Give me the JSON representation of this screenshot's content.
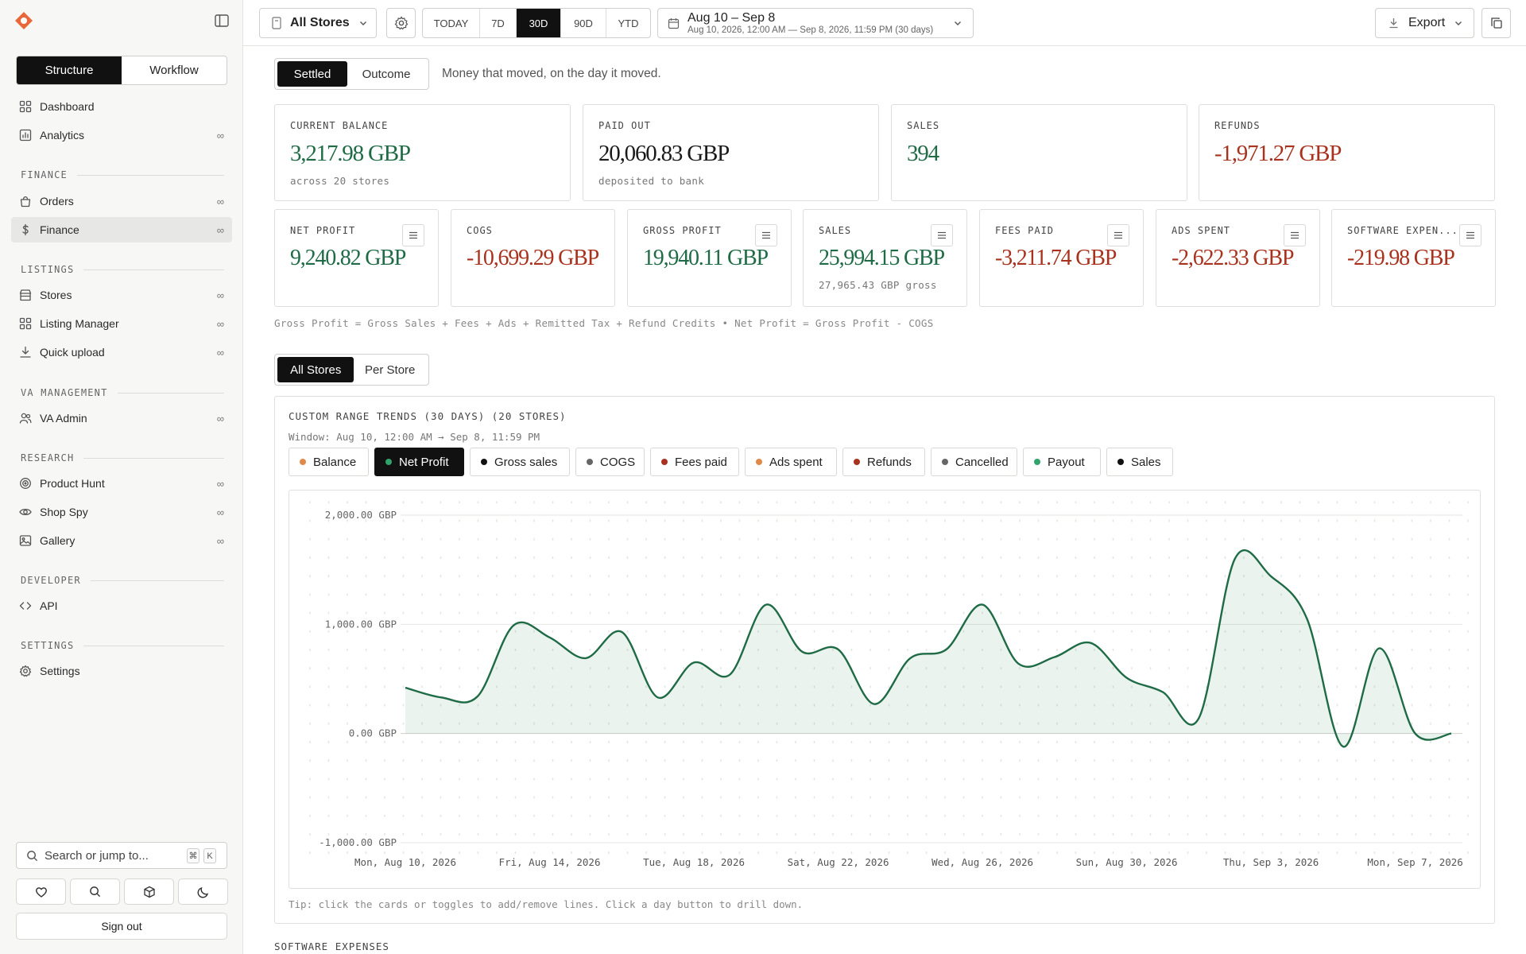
{
  "sidebar": {
    "tabs": [
      "Structure",
      "Workflow"
    ],
    "top_items": [
      {
        "label": "Dashboard",
        "icon": "grid-icon",
        "badge": ""
      },
      {
        "label": "Analytics",
        "icon": "chart-icon",
        "badge": "∞"
      }
    ],
    "sections": [
      {
        "title": "FINANCE",
        "items": [
          {
            "label": "Orders",
            "icon": "bag-icon",
            "badge": "∞"
          },
          {
            "label": "Finance",
            "icon": "dollar-icon",
            "badge": "∞",
            "active": true
          }
        ]
      },
      {
        "title": "LISTINGS",
        "items": [
          {
            "label": "Stores",
            "icon": "store-icon",
            "badge": "∞"
          },
          {
            "label": "Listing Manager",
            "icon": "grid-icon",
            "badge": "∞"
          },
          {
            "label": "Quick upload",
            "icon": "download-icon",
            "badge": "∞"
          }
        ]
      },
      {
        "title": "VA MANAGEMENT",
        "items": [
          {
            "label": "VA Admin",
            "icon": "users-icon",
            "badge": "∞"
          }
        ]
      },
      {
        "title": "RESEARCH",
        "items": [
          {
            "label": "Product Hunt",
            "icon": "target-icon",
            "badge": "∞"
          },
          {
            "label": "Shop Spy",
            "icon": "eye-icon",
            "badge": "∞"
          },
          {
            "label": "Gallery",
            "icon": "image-icon",
            "badge": "∞"
          }
        ]
      },
      {
        "title": "DEVELOPER",
        "items": [
          {
            "label": "API",
            "icon": "code-icon",
            "badge": ""
          }
        ]
      },
      {
        "title": "SETTINGS",
        "items": [
          {
            "label": "Settings",
            "icon": "gear-icon",
            "badge": ""
          }
        ]
      }
    ],
    "search_placeholder": "Search or jump to...",
    "kbd": [
      "⌘",
      "K"
    ],
    "sign_out": "Sign out"
  },
  "topbar": {
    "store_select": "All Stores",
    "ranges": [
      "TODAY",
      "7D",
      "30D",
      "90D",
      "YTD"
    ],
    "active_range": "30D",
    "date_title": "Aug 10 – Sep 8",
    "date_sub": "Aug 10, 2026, 12:00 AM — Sep 8, 2026, 11:59 PM (30 days)",
    "export": "Export"
  },
  "mode": {
    "tabs": [
      "Settled",
      "Outcome"
    ],
    "active": "Settled",
    "description": "Money that moved, on the day it moved."
  },
  "summary_cards": [
    {
      "label": "CURRENT BALANCE",
      "value": "3,217.98 GBP",
      "sub": "across 20 stores",
      "tone": "green"
    },
    {
      "label": "PAID OUT",
      "value": "20,060.83 GBP",
      "sub": "deposited to bank",
      "tone": "black"
    },
    {
      "label": "SALES",
      "value": "394",
      "sub": "",
      "tone": "green"
    },
    {
      "label": "REFUNDS",
      "value": "-1,971.27 GBP",
      "sub": "",
      "tone": "red"
    }
  ],
  "metric_cards": [
    {
      "label": "NET PROFIT",
      "value": "9,240.82 GBP",
      "sub": "",
      "tone": "green"
    },
    {
      "label": "COGS",
      "value": "-10,699.29 GBP",
      "sub": "",
      "tone": "red"
    },
    {
      "label": "GROSS PROFIT",
      "value": "19,940.11 GBP",
      "sub": "",
      "tone": "green"
    },
    {
      "label": "SALES",
      "value": "25,994.15 GBP",
      "sub": "27,965.43 GBP gross",
      "tone": "green"
    },
    {
      "label": "FEES PAID",
      "value": "-3,211.74 GBP",
      "sub": "",
      "tone": "red"
    },
    {
      "label": "ADS SPENT",
      "value": "-2,622.33 GBP",
      "sub": "",
      "tone": "red"
    },
    {
      "label": "SOFTWARE EXPEN...",
      "value": "-219.98 GBP",
      "sub": "",
      "tone": "red"
    }
  ],
  "formula": "Gross Profit = Gross Sales + Fees + Ads + Remitted Tax + Refund Credits  •  Net Profit = Gross Profit - COGS",
  "store_view": {
    "tabs": [
      "All Stores",
      "Per Store"
    ],
    "active": "All Stores"
  },
  "trends": {
    "title": "CUSTOM RANGE TRENDS (30 DAYS) (20 STORES)",
    "window": "Window: Aug 10, 12:00 AM → Sep 8, 11:59 PM",
    "toggles": [
      {
        "label": "Balance",
        "color": "#e08a4a",
        "on": false
      },
      {
        "label": "Net Profit",
        "color": "#2fa36b",
        "on": true
      },
      {
        "label": "Gross sales",
        "color": "#111111",
        "on": false
      },
      {
        "label": "COGS",
        "color": "#666666",
        "on": false
      },
      {
        "label": "Fees paid",
        "color": "#a8321e",
        "on": false
      },
      {
        "label": "Ads spent",
        "color": "#e08a4a",
        "on": false
      },
      {
        "label": "Refunds",
        "color": "#a8321e",
        "on": false
      },
      {
        "label": "Cancelled",
        "color": "#666666",
        "on": false
      },
      {
        "label": "Payout",
        "color": "#2fa36b",
        "on": false
      },
      {
        "label": "Sales",
        "color": "#111111",
        "on": false
      }
    ],
    "tip": "Tip: click the cards or toggles to add/remove lines. Click a day button to drill down."
  },
  "chart_data": {
    "type": "area",
    "title": "",
    "xlabel": "",
    "ylabel": "",
    "ylim": [
      -1000,
      2000
    ],
    "yticks": [
      2000,
      1000,
      0,
      -1000
    ],
    "ytick_labels": [
      "2,000.00 GBP",
      "1,000.00 GBP",
      "0.00 GBP",
      "-1,000.00 GBP"
    ],
    "x_ticks": [
      {
        "day": 0,
        "label": "Mon, Aug 10, 2026"
      },
      {
        "day": 4,
        "label": "Fri, Aug 14, 2026"
      },
      {
        "day": 8,
        "label": "Tue, Aug 18, 2026"
      },
      {
        "day": 12,
        "label": "Sat, Aug 22, 2026"
      },
      {
        "day": 16,
        "label": "Wed, Aug 26, 2026"
      },
      {
        "day": 20,
        "label": "Sun, Aug 30, 2026"
      },
      {
        "day": 24,
        "label": "Thu, Sep 3, 2026"
      },
      {
        "day": 28,
        "label": "Mon, Sep 7, 2026"
      }
    ],
    "grid": true,
    "series": [
      {
        "name": "Net Profit",
        "color": "#1f6b45",
        "x": [
          "2026-08-10",
          "2026-08-11",
          "2026-08-12",
          "2026-08-13",
          "2026-08-14",
          "2026-08-15",
          "2026-08-16",
          "2026-08-17",
          "2026-08-18",
          "2026-08-19",
          "2026-08-20",
          "2026-08-21",
          "2026-08-22",
          "2026-08-23",
          "2026-08-24",
          "2026-08-25",
          "2026-08-26",
          "2026-08-27",
          "2026-08-28",
          "2026-08-29",
          "2026-08-30",
          "2026-08-31",
          "2026-09-01",
          "2026-09-02",
          "2026-09-03",
          "2026-09-04",
          "2026-09-05",
          "2026-09-06",
          "2026-09-07",
          "2026-09-08"
        ],
        "values": [
          420,
          330,
          340,
          990,
          880,
          690,
          930,
          330,
          650,
          540,
          1180,
          750,
          770,
          270,
          690,
          770,
          1180,
          640,
          700,
          830,
          510,
          380,
          140,
          1600,
          1440,
          1050,
          -120,
          780,
          0,
          0
        ]
      }
    ]
  },
  "next_section": "SOFTWARE EXPENSES"
}
